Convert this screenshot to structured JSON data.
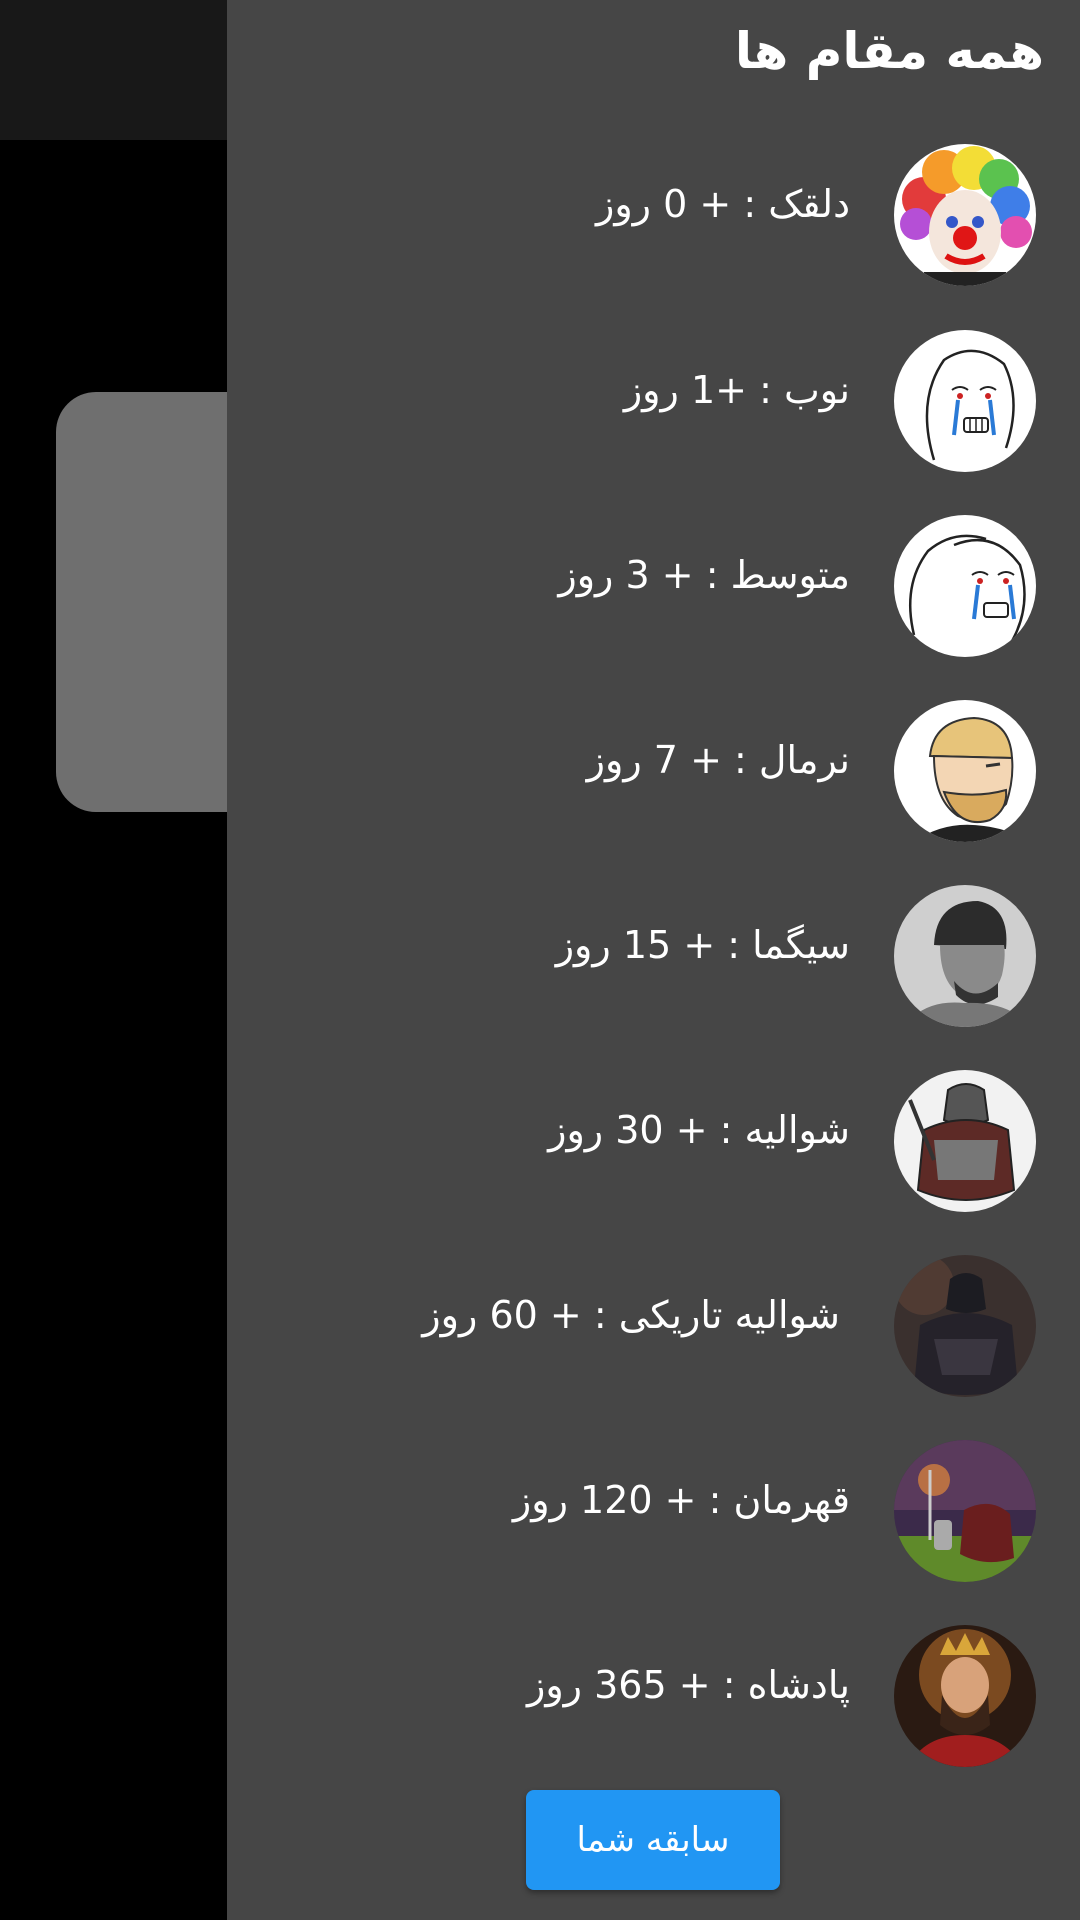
{
  "drawer": {
    "title": "همه مقام ها",
    "ranks": [
      {
        "name": "دلقک",
        "sep": ":",
        "plus": "+",
        "days": "0",
        "unit": "روز",
        "icon": "clown-avatar-icon"
      },
      {
        "name": "نوب",
        "sep": ":",
        "plus": "+",
        "days": "1",
        "unit": "روز",
        "icon": "crying-wojak-avatar-icon"
      },
      {
        "name": "متوسط",
        "sep": ":",
        "plus": "+",
        "days": "3",
        "unit": "روز",
        "icon": "crying-wojak-mask-avatar-icon"
      },
      {
        "name": "نرمال",
        "sep": ":",
        "plus": "+",
        "days": "7",
        "unit": "روز",
        "icon": "yes-chad-avatar-icon"
      },
      {
        "name": "سیگما",
        "sep": ":",
        "plus": "+",
        "days": "15",
        "unit": "روز",
        "icon": "gigachad-avatar-icon"
      },
      {
        "name": "شوالیه",
        "sep": ":",
        "plus": "+",
        "days": "30",
        "unit": "روز",
        "icon": "knight-avatar-icon"
      },
      {
        "name": "شوالیه تاریکی",
        "sep": ":",
        "plus": "+",
        "days": "60",
        "unit": "روز",
        "icon": "dark-knight-avatar-icon"
      },
      {
        "name": "قهرمان",
        "sep": ":",
        "plus": "+",
        "days": "120",
        "unit": "روز",
        "icon": "hero-avatar-icon"
      },
      {
        "name": "پادشاه",
        "sep": ":",
        "plus": "+",
        "days": "365",
        "unit": "روز",
        "icon": "king-avatar-icon"
      }
    ],
    "history_button": "سابقه شما"
  },
  "colors": {
    "drawer_bg": "#464646",
    "button_bg": "#2196f3",
    "text": "#ffffff"
  }
}
